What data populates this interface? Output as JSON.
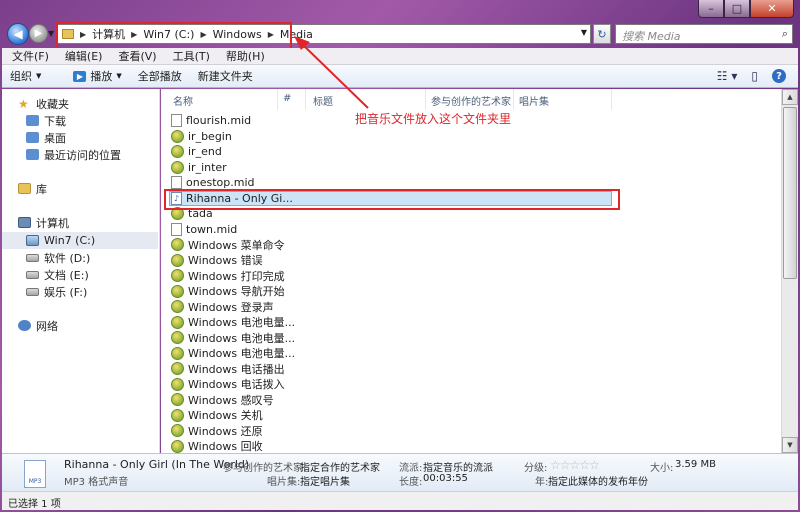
{
  "window": {
    "min_label": "–",
    "max_label": "□",
    "close_label": "✕"
  },
  "address": {
    "crumbs": [
      "计算机",
      "Win7 (C:)",
      "Windows",
      "Media"
    ]
  },
  "search": {
    "placeholder": "搜索 Media"
  },
  "menu": [
    "文件(F)",
    "编辑(E)",
    "查看(V)",
    "工具(T)",
    "帮助(H)"
  ],
  "toolbar": {
    "organize": "组织",
    "play": "播放",
    "play_all": "全部播放",
    "new_folder": "新建文件夹"
  },
  "nav": {
    "favorites": "收藏夹",
    "downloads": "下载",
    "desktop": "桌面",
    "recent": "最近访问的位置",
    "libraries": "库",
    "computer": "计算机",
    "drive_c": "Win7 (C:)",
    "drive_d": "软件 (D:)",
    "drive_e": "文档 (E:)",
    "drive_f": "娱乐 (F:)",
    "network": "网络"
  },
  "columns": [
    "名称",
    "#",
    "标题",
    "参与创作的艺术家",
    "唱片集"
  ],
  "files": [
    {
      "name": "flourish.mid",
      "icon": "doc"
    },
    {
      "name": "ir_begin",
      "icon": "wav"
    },
    {
      "name": "ir_end",
      "icon": "wav"
    },
    {
      "name": "ir_inter",
      "icon": "wav"
    },
    {
      "name": "onestop.mid",
      "icon": "doc"
    },
    {
      "name": "Rihanna - Only Gi...",
      "icon": "mp3"
    },
    {
      "name": "tada",
      "icon": "wav"
    },
    {
      "name": "town.mid",
      "icon": "doc"
    },
    {
      "name": "Windows 菜单命令",
      "icon": "wav"
    },
    {
      "name": "Windows 错误",
      "icon": "wav"
    },
    {
      "name": "Windows 打印完成",
      "icon": "wav"
    },
    {
      "name": "Windows 导航开始",
      "icon": "wav"
    },
    {
      "name": "Windows 登录声",
      "icon": "wav"
    },
    {
      "name": "Windows 电池电量...",
      "icon": "wav"
    },
    {
      "name": "Windows 电池电量...",
      "icon": "wav"
    },
    {
      "name": "Windows 电池电量...",
      "icon": "wav"
    },
    {
      "name": "Windows 电话播出",
      "icon": "wav"
    },
    {
      "name": "Windows 电话拨入",
      "icon": "wav"
    },
    {
      "name": "Windows 感叹号",
      "icon": "wav"
    },
    {
      "name": "Windows 关机",
      "icon": "wav"
    },
    {
      "name": "Windows 还原",
      "icon": "wav"
    },
    {
      "name": "Windows 回收",
      "icon": "wav"
    }
  ],
  "annotation": "把音乐文件放入这个文件夹里",
  "details": {
    "title": "Rihanna - Only Girl (In The World)",
    "type": "MP3 格式声音",
    "artist_label": "参与创作的艺术家:",
    "artist_value": "指定合作的艺术家",
    "album_label": "唱片集:",
    "album_value": "指定唱片集",
    "genre_label": "流派:",
    "genre_value": "指定音乐的流派",
    "length_label": "长度:",
    "length_value": "00:03:55",
    "rating_label": "分级:",
    "year_label": "年:",
    "year_value": "指定此媒体的发布年份",
    "size_label": "大小:",
    "size_value": "3.59 MB",
    "mp3_badge": "MP3"
  },
  "status": "已选择 1 项"
}
